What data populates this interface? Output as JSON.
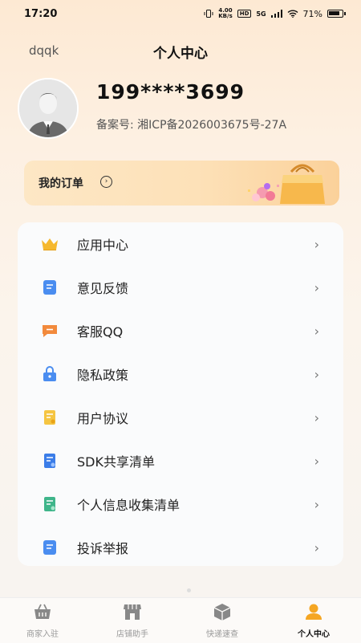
{
  "status_bar": {
    "time": "17:20",
    "speed_top": "4.00",
    "speed_bottom": "KB/s",
    "hd": "HD",
    "network": "5G",
    "battery": "71%"
  },
  "header": {
    "left_text": "dqqk",
    "title": "个人中心"
  },
  "profile": {
    "phone": "199****3699",
    "icp": "备案号: 湘ICP备2026003675号-27A"
  },
  "order": {
    "label": "我的订单",
    "arrow": "›"
  },
  "menu": {
    "chevron": "›",
    "items": [
      {
        "label": "应用中心",
        "icon": "crown-icon"
      },
      {
        "label": "意见反馈",
        "icon": "feedback-icon"
      },
      {
        "label": "客服QQ",
        "icon": "chat-icon"
      },
      {
        "label": "隐私政策",
        "icon": "lock-icon"
      },
      {
        "label": "用户协议",
        "icon": "document-icon"
      },
      {
        "label": "SDK共享清单",
        "icon": "sdk-list-icon"
      },
      {
        "label": "个人信息收集清单",
        "icon": "personal-info-icon"
      },
      {
        "label": "投诉举报",
        "icon": "report-icon"
      }
    ]
  },
  "tabs": [
    {
      "label": "商家入驻",
      "icon": "basket-icon",
      "active": false
    },
    {
      "label": "店铺助手",
      "icon": "store-icon",
      "active": false
    },
    {
      "label": "快递速查",
      "icon": "package-icon",
      "active": false
    },
    {
      "label": "个人中心",
      "icon": "user-icon",
      "active": true
    }
  ],
  "colors": {
    "accent": "#f5a623",
    "blue": "#4a8df0",
    "orange": "#f28a3c",
    "green": "#3fb58a"
  }
}
